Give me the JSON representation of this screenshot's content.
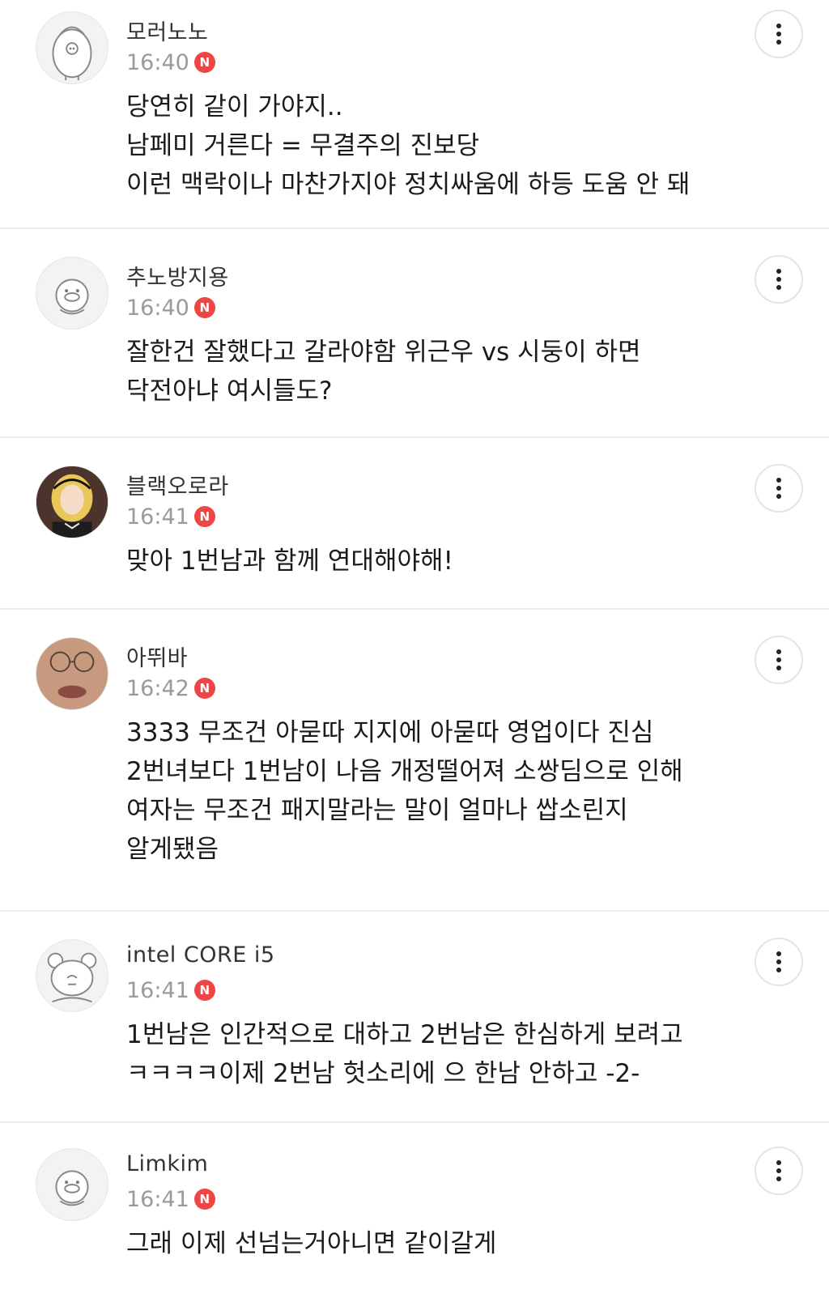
{
  "comments": [
    {
      "nickname": "모러노노",
      "time": "16:40",
      "badge": "N",
      "avatar": "penguin-character-icon",
      "lines": [
        "당연히 같이 가야지..",
        "남페미 거른다 = 무결주의 진보당",
        "이런 맥락이나 마찬가지야 정치싸움에 하등 도움 안 돼"
      ]
    },
    {
      "nickname": "추노방지용",
      "time": "16:40",
      "badge": "N",
      "avatar": "duck-character-icon",
      "lines": [
        "잘한건 잘했다고 갈라야함 위근우 vs 시둥이 하면",
        "닥전아냐 여시들도?"
      ]
    },
    {
      "nickname": "블랙오로라",
      "time": "16:41",
      "badge": "N",
      "avatar": "princess-portrait-photo",
      "lines": [
        "맞아 1번남과 함께 연대해야해!"
      ]
    },
    {
      "nickname": "아뛰바",
      "time": "16:42",
      "badge": "N",
      "avatar": "face-closeup-photo",
      "lines": [
        "3333 무조건 아묻따 지지에 아묻따 영업이다 진심",
        "2번녀보다 1번남이 나음 개정떨어져 소쌍딤으로 인해",
        "여자는 무조건 패지말라는 말이 얼마나 쌉소린지",
        "알게됐음"
      ]
    },
    {
      "nickname": "intel CORE i5",
      "time": "16:41",
      "badge": "N",
      "avatar": "bear-character-icon",
      "lines": [
        "1번남은 인간적으로 대하고 2번남은 한심하게 보려고",
        "ㅋㅋㅋㅋ이제 2번남 헛소리에 으 한남 안하고 -2-"
      ]
    },
    {
      "nickname": "Limkim",
      "time": "16:41",
      "badge": "N",
      "avatar": "duck-character-icon",
      "lines": [
        "그래 이제 선넘는거아니면 같이갈게"
      ]
    }
  ],
  "icons": {
    "more": "more-vertical-icon"
  },
  "colors": {
    "badge": "#ef4545",
    "time": "#9a9a9a",
    "divider": "#ececec"
  }
}
